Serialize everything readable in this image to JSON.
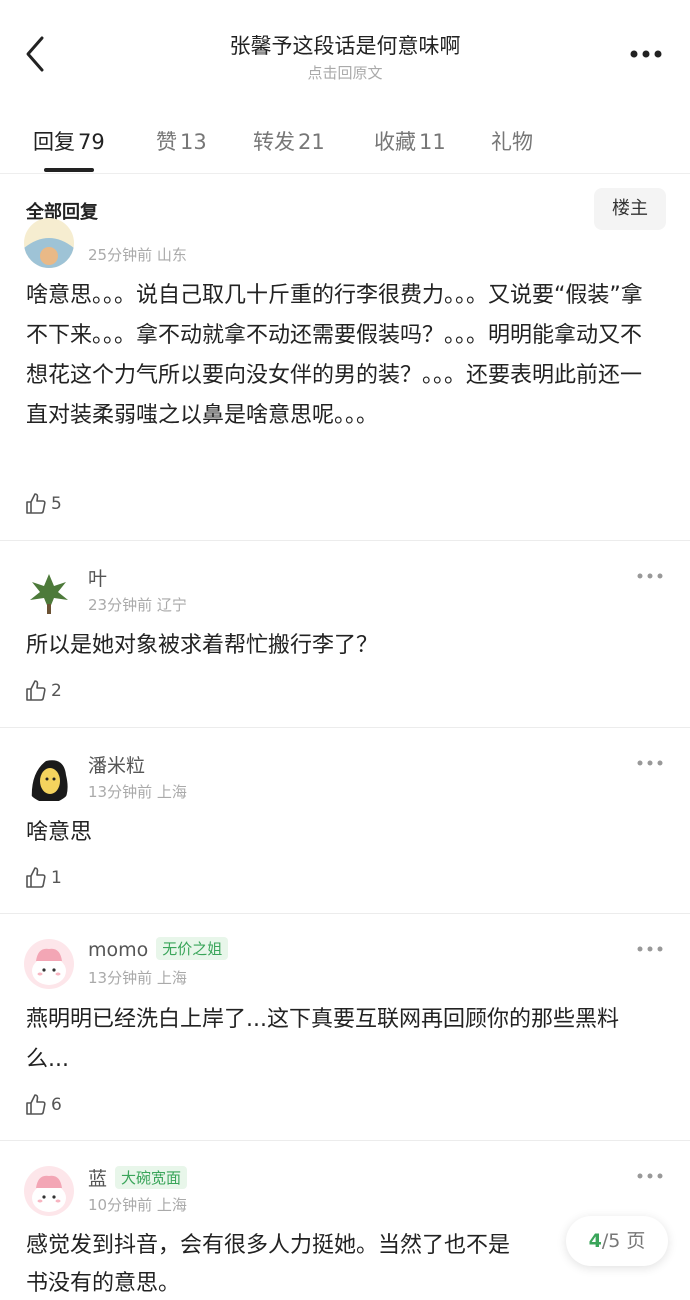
{
  "header": {
    "title": "张馨予这段话是何意味啊",
    "subtitle": "点击回原文"
  },
  "tabs": [
    {
      "label": "回复",
      "count": "79"
    },
    {
      "label": "赞",
      "count": "13"
    },
    {
      "label": "转发",
      "count": "21"
    },
    {
      "label": "收藏",
      "count": "11"
    },
    {
      "label": "礼物",
      "count": ""
    }
  ],
  "section": {
    "title": "全部回复",
    "owner_filter": "楼主"
  },
  "comments": [
    {
      "name": "",
      "meta": "25分钟前 山东",
      "text": "啥意思。。。说自己取几十斤重的行李很费力。。。又说要“假装”拿不下来。。。拿不动就拿不动还需要假装吗？。。。明明能拿动又不想花这个力气所以要向没女伴的男的装？。。。还要表明此前还一直对装柔弱嗤之以鼻是啥意思呢。。。",
      "likes": "5"
    },
    {
      "name": "叶",
      "meta": "23分钟前 辽宁",
      "text": "所以是她对象被求着帮忙搬行李了？",
      "likes": "2"
    },
    {
      "name": "潘米粒",
      "meta": "13分钟前 上海",
      "text": "啥意思",
      "likes": "1"
    },
    {
      "name": "momo",
      "badge": "无价之姐",
      "meta": "13分钟前 上海",
      "text": "燕明明已经洗白上岸了...这下真要互联网再回顾你的那些黑料么...",
      "likes": "6"
    },
    {
      "name": "蓝",
      "badge": "大碗宽面",
      "meta": "10分钟前 上海",
      "text": "感觉发到抖音，会有很多人力挺她。当然了也不是",
      "text2": "书没有的意思。"
    }
  ],
  "pager": {
    "current": "4",
    "total": "/5 页"
  },
  "colors": {
    "accent_green": "#3aa55a",
    "badge_bg": "#e8f6ea",
    "text": "#222222",
    "muted": "#aaaaaa"
  },
  "icons": [
    "back-arrow-icon",
    "more-dots-icon",
    "thumbs-up-icon"
  ]
}
